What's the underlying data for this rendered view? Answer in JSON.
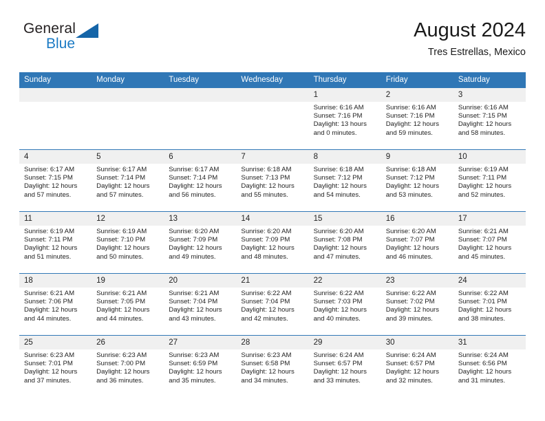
{
  "branding": {
    "name_top": "General",
    "name_bottom": "Blue",
    "triangle_icon": "triangle-icon",
    "accent_color": "#1565a8",
    "blue_text_color": "#1b7ac4"
  },
  "header": {
    "title": "August 2024",
    "location": "Tres Estrellas, Mexico",
    "header_bg_color": "#3077b6",
    "day_band_color": "#f0f0f0"
  },
  "weekdays": [
    {
      "label": "Sunday"
    },
    {
      "label": "Monday"
    },
    {
      "label": "Tuesday"
    },
    {
      "label": "Wednesday"
    },
    {
      "label": "Thursday"
    },
    {
      "label": "Friday"
    },
    {
      "label": "Saturday"
    }
  ],
  "weeks": [
    [
      {
        "day": "",
        "sunrise": "",
        "sunset": "",
        "daylight_line1": "",
        "daylight_line2": ""
      },
      {
        "day": "",
        "sunrise": "",
        "sunset": "",
        "daylight_line1": "",
        "daylight_line2": ""
      },
      {
        "day": "",
        "sunrise": "",
        "sunset": "",
        "daylight_line1": "",
        "daylight_line2": ""
      },
      {
        "day": "",
        "sunrise": "",
        "sunset": "",
        "daylight_line1": "",
        "daylight_line2": ""
      },
      {
        "day": "1",
        "sunrise": "Sunrise: 6:16 AM",
        "sunset": "Sunset: 7:16 PM",
        "daylight_line1": "Daylight: 13 hours",
        "daylight_line2": "and 0 minutes."
      },
      {
        "day": "2",
        "sunrise": "Sunrise: 6:16 AM",
        "sunset": "Sunset: 7:16 PM",
        "daylight_line1": "Daylight: 12 hours",
        "daylight_line2": "and 59 minutes."
      },
      {
        "day": "3",
        "sunrise": "Sunrise: 6:16 AM",
        "sunset": "Sunset: 7:15 PM",
        "daylight_line1": "Daylight: 12 hours",
        "daylight_line2": "and 58 minutes."
      }
    ],
    [
      {
        "day": "4",
        "sunrise": "Sunrise: 6:17 AM",
        "sunset": "Sunset: 7:15 PM",
        "daylight_line1": "Daylight: 12 hours",
        "daylight_line2": "and 57 minutes."
      },
      {
        "day": "5",
        "sunrise": "Sunrise: 6:17 AM",
        "sunset": "Sunset: 7:14 PM",
        "daylight_line1": "Daylight: 12 hours",
        "daylight_line2": "and 57 minutes."
      },
      {
        "day": "6",
        "sunrise": "Sunrise: 6:17 AM",
        "sunset": "Sunset: 7:14 PM",
        "daylight_line1": "Daylight: 12 hours",
        "daylight_line2": "and 56 minutes."
      },
      {
        "day": "7",
        "sunrise": "Sunrise: 6:18 AM",
        "sunset": "Sunset: 7:13 PM",
        "daylight_line1": "Daylight: 12 hours",
        "daylight_line2": "and 55 minutes."
      },
      {
        "day": "8",
        "sunrise": "Sunrise: 6:18 AM",
        "sunset": "Sunset: 7:12 PM",
        "daylight_line1": "Daylight: 12 hours",
        "daylight_line2": "and 54 minutes."
      },
      {
        "day": "9",
        "sunrise": "Sunrise: 6:18 AM",
        "sunset": "Sunset: 7:12 PM",
        "daylight_line1": "Daylight: 12 hours",
        "daylight_line2": "and 53 minutes."
      },
      {
        "day": "10",
        "sunrise": "Sunrise: 6:19 AM",
        "sunset": "Sunset: 7:11 PM",
        "daylight_line1": "Daylight: 12 hours",
        "daylight_line2": "and 52 minutes."
      }
    ],
    [
      {
        "day": "11",
        "sunrise": "Sunrise: 6:19 AM",
        "sunset": "Sunset: 7:11 PM",
        "daylight_line1": "Daylight: 12 hours",
        "daylight_line2": "and 51 minutes."
      },
      {
        "day": "12",
        "sunrise": "Sunrise: 6:19 AM",
        "sunset": "Sunset: 7:10 PM",
        "daylight_line1": "Daylight: 12 hours",
        "daylight_line2": "and 50 minutes."
      },
      {
        "day": "13",
        "sunrise": "Sunrise: 6:20 AM",
        "sunset": "Sunset: 7:09 PM",
        "daylight_line1": "Daylight: 12 hours",
        "daylight_line2": "and 49 minutes."
      },
      {
        "day": "14",
        "sunrise": "Sunrise: 6:20 AM",
        "sunset": "Sunset: 7:09 PM",
        "daylight_line1": "Daylight: 12 hours",
        "daylight_line2": "and 48 minutes."
      },
      {
        "day": "15",
        "sunrise": "Sunrise: 6:20 AM",
        "sunset": "Sunset: 7:08 PM",
        "daylight_line1": "Daylight: 12 hours",
        "daylight_line2": "and 47 minutes."
      },
      {
        "day": "16",
        "sunrise": "Sunrise: 6:20 AM",
        "sunset": "Sunset: 7:07 PM",
        "daylight_line1": "Daylight: 12 hours",
        "daylight_line2": "and 46 minutes."
      },
      {
        "day": "17",
        "sunrise": "Sunrise: 6:21 AM",
        "sunset": "Sunset: 7:07 PM",
        "daylight_line1": "Daylight: 12 hours",
        "daylight_line2": "and 45 minutes."
      }
    ],
    [
      {
        "day": "18",
        "sunrise": "Sunrise: 6:21 AM",
        "sunset": "Sunset: 7:06 PM",
        "daylight_line1": "Daylight: 12 hours",
        "daylight_line2": "and 44 minutes."
      },
      {
        "day": "19",
        "sunrise": "Sunrise: 6:21 AM",
        "sunset": "Sunset: 7:05 PM",
        "daylight_line1": "Daylight: 12 hours",
        "daylight_line2": "and 44 minutes."
      },
      {
        "day": "20",
        "sunrise": "Sunrise: 6:21 AM",
        "sunset": "Sunset: 7:04 PM",
        "daylight_line1": "Daylight: 12 hours",
        "daylight_line2": "and 43 minutes."
      },
      {
        "day": "21",
        "sunrise": "Sunrise: 6:22 AM",
        "sunset": "Sunset: 7:04 PM",
        "daylight_line1": "Daylight: 12 hours",
        "daylight_line2": "and 42 minutes."
      },
      {
        "day": "22",
        "sunrise": "Sunrise: 6:22 AM",
        "sunset": "Sunset: 7:03 PM",
        "daylight_line1": "Daylight: 12 hours",
        "daylight_line2": "and 40 minutes."
      },
      {
        "day": "23",
        "sunrise": "Sunrise: 6:22 AM",
        "sunset": "Sunset: 7:02 PM",
        "daylight_line1": "Daylight: 12 hours",
        "daylight_line2": "and 39 minutes."
      },
      {
        "day": "24",
        "sunrise": "Sunrise: 6:22 AM",
        "sunset": "Sunset: 7:01 PM",
        "daylight_line1": "Daylight: 12 hours",
        "daylight_line2": "and 38 minutes."
      }
    ],
    [
      {
        "day": "25",
        "sunrise": "Sunrise: 6:23 AM",
        "sunset": "Sunset: 7:01 PM",
        "daylight_line1": "Daylight: 12 hours",
        "daylight_line2": "and 37 minutes."
      },
      {
        "day": "26",
        "sunrise": "Sunrise: 6:23 AM",
        "sunset": "Sunset: 7:00 PM",
        "daylight_line1": "Daylight: 12 hours",
        "daylight_line2": "and 36 minutes."
      },
      {
        "day": "27",
        "sunrise": "Sunrise: 6:23 AM",
        "sunset": "Sunset: 6:59 PM",
        "daylight_line1": "Daylight: 12 hours",
        "daylight_line2": "and 35 minutes."
      },
      {
        "day": "28",
        "sunrise": "Sunrise: 6:23 AM",
        "sunset": "Sunset: 6:58 PM",
        "daylight_line1": "Daylight: 12 hours",
        "daylight_line2": "and 34 minutes."
      },
      {
        "day": "29",
        "sunrise": "Sunrise: 6:24 AM",
        "sunset": "Sunset: 6:57 PM",
        "daylight_line1": "Daylight: 12 hours",
        "daylight_line2": "and 33 minutes."
      },
      {
        "day": "30",
        "sunrise": "Sunrise: 6:24 AM",
        "sunset": "Sunset: 6:57 PM",
        "daylight_line1": "Daylight: 12 hours",
        "daylight_line2": "and 32 minutes."
      },
      {
        "day": "31",
        "sunrise": "Sunrise: 6:24 AM",
        "sunset": "Sunset: 6:56 PM",
        "daylight_line1": "Daylight: 12 hours",
        "daylight_line2": "and 31 minutes."
      }
    ]
  ]
}
